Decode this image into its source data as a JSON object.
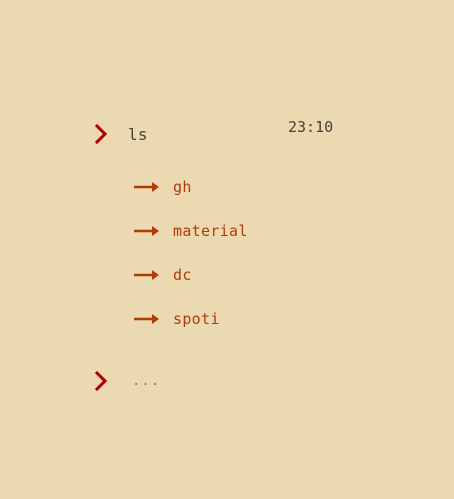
{
  "prompt": {
    "command": "ls",
    "time": "23:10"
  },
  "links": [
    {
      "label": "gh",
      "icon": "arrow-right-icon"
    },
    {
      "label": "material",
      "icon": "arrow-right-icon"
    },
    {
      "label": "dc",
      "icon": "arrow-right-icon"
    },
    {
      "label": "spoti",
      "icon": "arrow-right-icon"
    }
  ],
  "next_prompt": {
    "text": "..."
  },
  "colors": {
    "background": "#ead9b1",
    "accent": "#b33b06",
    "chevron": "#b00000",
    "text": "#4a4036",
    "muted": "#8a7d6a"
  },
  "icons": {
    "prompt": "chevron-right-icon",
    "link": "arrow-right-icon"
  }
}
